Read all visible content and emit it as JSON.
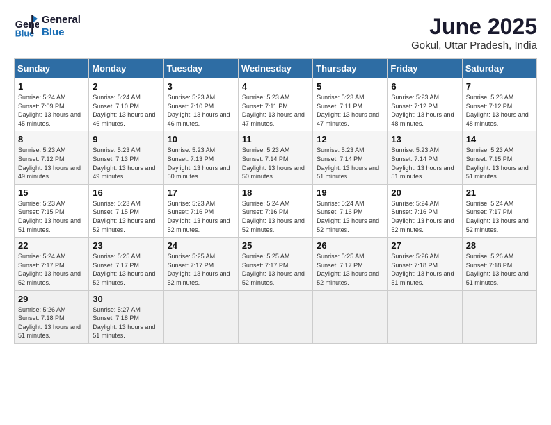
{
  "logo": {
    "line1": "General",
    "line2": "Blue"
  },
  "title": "June 2025",
  "location": "Gokul, Uttar Pradesh, India",
  "weekdays": [
    "Sunday",
    "Monday",
    "Tuesday",
    "Wednesday",
    "Thursday",
    "Friday",
    "Saturday"
  ],
  "weeks": [
    [
      {
        "day": "1",
        "sunrise": "5:24 AM",
        "sunset": "7:09 PM",
        "daylight": "13 hours and 45 minutes."
      },
      {
        "day": "2",
        "sunrise": "5:24 AM",
        "sunset": "7:10 PM",
        "daylight": "13 hours and 46 minutes."
      },
      {
        "day": "3",
        "sunrise": "5:23 AM",
        "sunset": "7:10 PM",
        "daylight": "13 hours and 46 minutes."
      },
      {
        "day": "4",
        "sunrise": "5:23 AM",
        "sunset": "7:11 PM",
        "daylight": "13 hours and 47 minutes."
      },
      {
        "day": "5",
        "sunrise": "5:23 AM",
        "sunset": "7:11 PM",
        "daylight": "13 hours and 47 minutes."
      },
      {
        "day": "6",
        "sunrise": "5:23 AM",
        "sunset": "7:12 PM",
        "daylight": "13 hours and 48 minutes."
      },
      {
        "day": "7",
        "sunrise": "5:23 AM",
        "sunset": "7:12 PM",
        "daylight": "13 hours and 48 minutes."
      }
    ],
    [
      {
        "day": "8",
        "sunrise": "5:23 AM",
        "sunset": "7:12 PM",
        "daylight": "13 hours and 49 minutes."
      },
      {
        "day": "9",
        "sunrise": "5:23 AM",
        "sunset": "7:13 PM",
        "daylight": "13 hours and 49 minutes."
      },
      {
        "day": "10",
        "sunrise": "5:23 AM",
        "sunset": "7:13 PM",
        "daylight": "13 hours and 50 minutes."
      },
      {
        "day": "11",
        "sunrise": "5:23 AM",
        "sunset": "7:14 PM",
        "daylight": "13 hours and 50 minutes."
      },
      {
        "day": "12",
        "sunrise": "5:23 AM",
        "sunset": "7:14 PM",
        "daylight": "13 hours and 51 minutes."
      },
      {
        "day": "13",
        "sunrise": "5:23 AM",
        "sunset": "7:14 PM",
        "daylight": "13 hours and 51 minutes."
      },
      {
        "day": "14",
        "sunrise": "5:23 AM",
        "sunset": "7:15 PM",
        "daylight": "13 hours and 51 minutes."
      }
    ],
    [
      {
        "day": "15",
        "sunrise": "5:23 AM",
        "sunset": "7:15 PM",
        "daylight": "13 hours and 51 minutes."
      },
      {
        "day": "16",
        "sunrise": "5:23 AM",
        "sunset": "7:15 PM",
        "daylight": "13 hours and 52 minutes."
      },
      {
        "day": "17",
        "sunrise": "5:23 AM",
        "sunset": "7:16 PM",
        "daylight": "13 hours and 52 minutes."
      },
      {
        "day": "18",
        "sunrise": "5:24 AM",
        "sunset": "7:16 PM",
        "daylight": "13 hours and 52 minutes."
      },
      {
        "day": "19",
        "sunrise": "5:24 AM",
        "sunset": "7:16 PM",
        "daylight": "13 hours and 52 minutes."
      },
      {
        "day": "20",
        "sunrise": "5:24 AM",
        "sunset": "7:16 PM",
        "daylight": "13 hours and 52 minutes."
      },
      {
        "day": "21",
        "sunrise": "5:24 AM",
        "sunset": "7:17 PM",
        "daylight": "13 hours and 52 minutes."
      }
    ],
    [
      {
        "day": "22",
        "sunrise": "5:24 AM",
        "sunset": "7:17 PM",
        "daylight": "13 hours and 52 minutes."
      },
      {
        "day": "23",
        "sunrise": "5:25 AM",
        "sunset": "7:17 PM",
        "daylight": "13 hours and 52 minutes."
      },
      {
        "day": "24",
        "sunrise": "5:25 AM",
        "sunset": "7:17 PM",
        "daylight": "13 hours and 52 minutes."
      },
      {
        "day": "25",
        "sunrise": "5:25 AM",
        "sunset": "7:17 PM",
        "daylight": "13 hours and 52 minutes."
      },
      {
        "day": "26",
        "sunrise": "5:25 AM",
        "sunset": "7:17 PM",
        "daylight": "13 hours and 52 minutes."
      },
      {
        "day": "27",
        "sunrise": "5:26 AM",
        "sunset": "7:18 PM",
        "daylight": "13 hours and 51 minutes."
      },
      {
        "day": "28",
        "sunrise": "5:26 AM",
        "sunset": "7:18 PM",
        "daylight": "13 hours and 51 minutes."
      }
    ],
    [
      {
        "day": "29",
        "sunrise": "5:26 AM",
        "sunset": "7:18 PM",
        "daylight": "13 hours and 51 minutes."
      },
      {
        "day": "30",
        "sunrise": "5:27 AM",
        "sunset": "7:18 PM",
        "daylight": "13 hours and 51 minutes."
      },
      null,
      null,
      null,
      null,
      null
    ]
  ]
}
